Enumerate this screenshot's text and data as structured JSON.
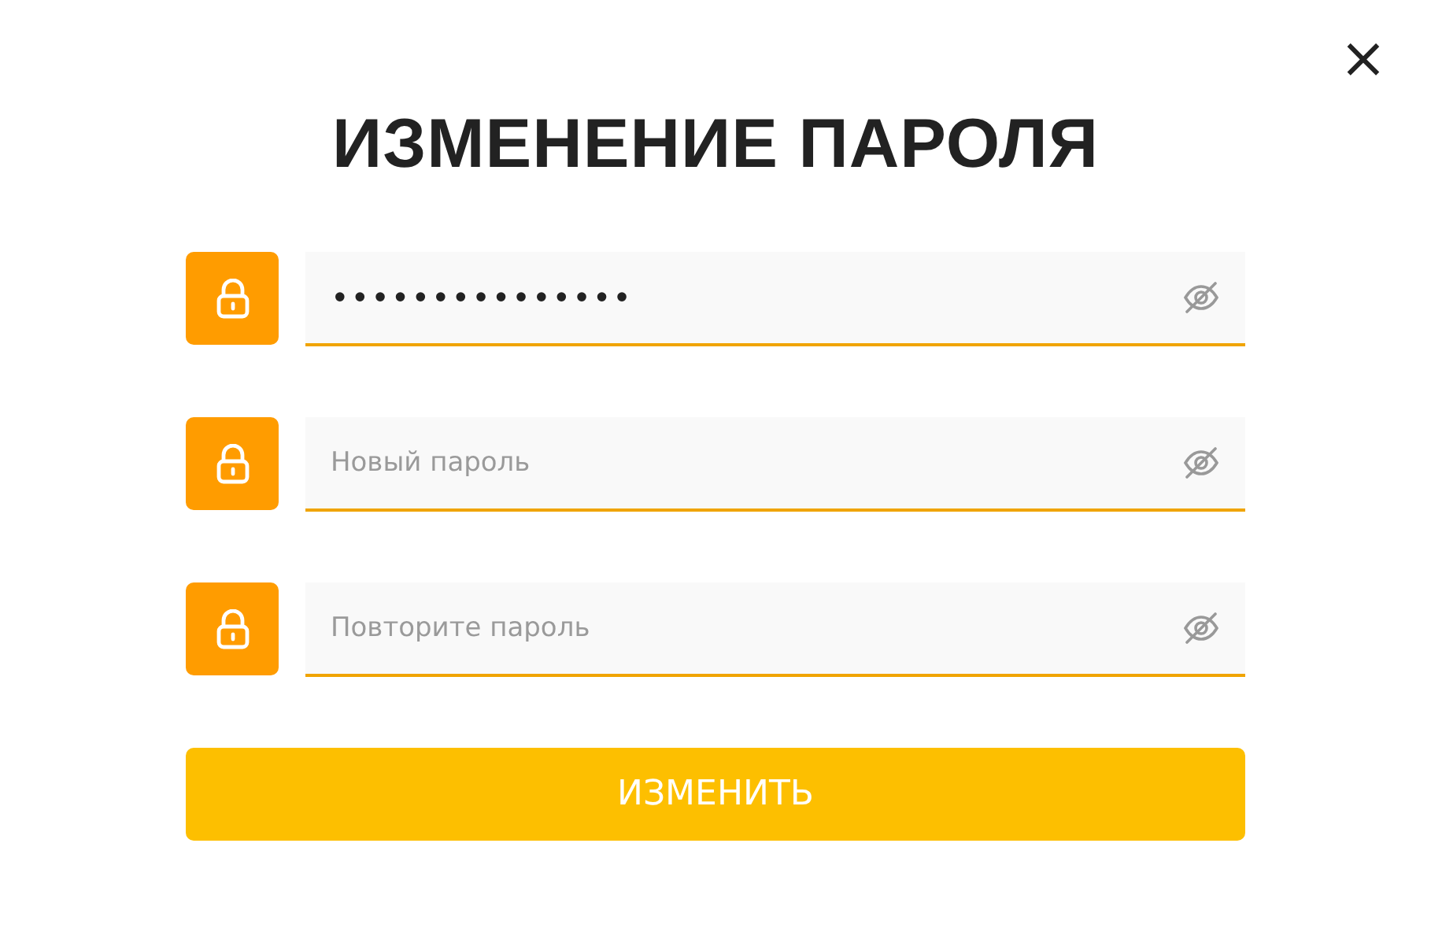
{
  "dialog": {
    "title": "ИЗМЕНЕНИЕ ПАРОЛЯ",
    "close": "×",
    "fields": [
      {
        "value": "•••••••••••••••"
      },
      {
        "placeholder": "Новый пароль"
      },
      {
        "placeholder": "Повторите пароль"
      }
    ],
    "submit": "ИЗМЕНИТЬ"
  }
}
